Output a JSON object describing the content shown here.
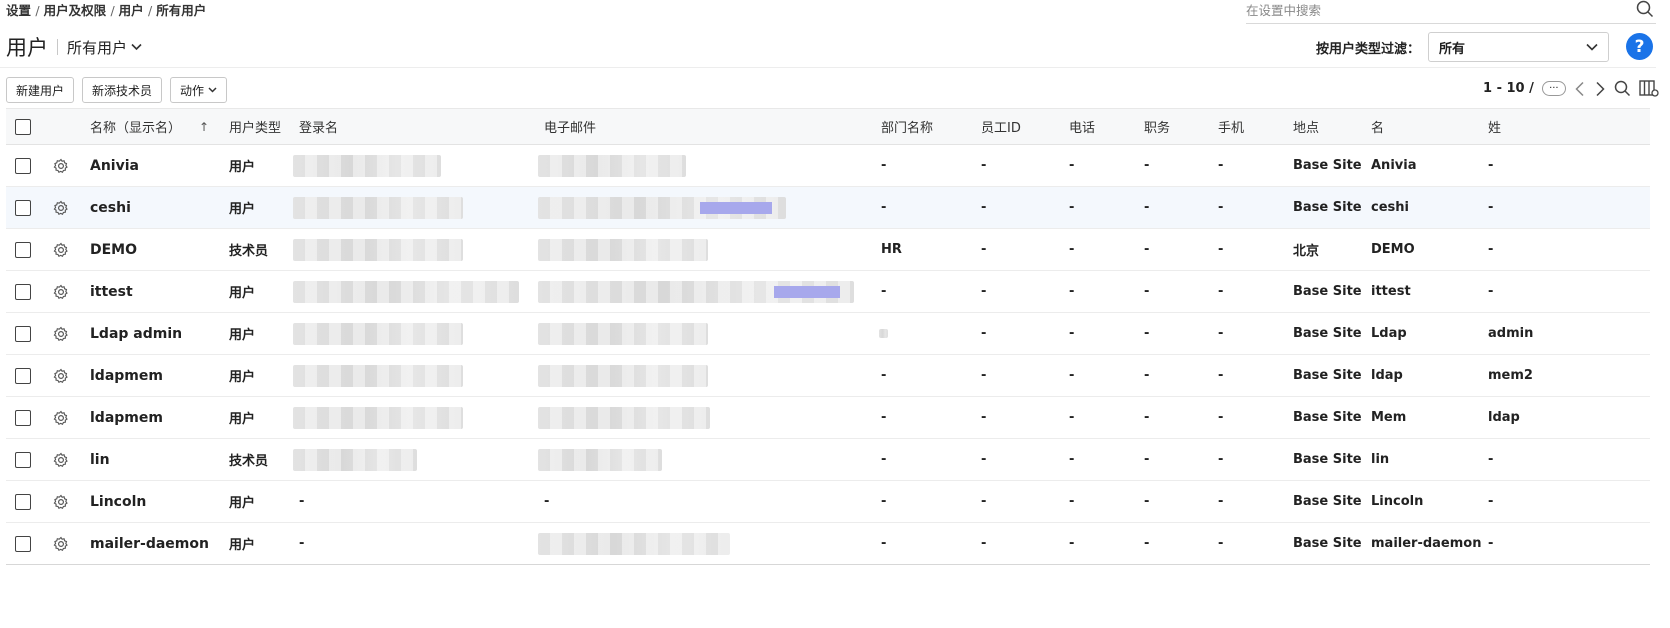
{
  "breadcrumb": [
    "设置",
    "用户及权限",
    "用户",
    "所有用户"
  ],
  "search": {
    "placeholder": "在设置中搜索"
  },
  "header": {
    "title": "用户",
    "view": "所有用户"
  },
  "filter": {
    "label": "按用户类型过滤：",
    "value": "所有"
  },
  "help": {
    "label": "?"
  },
  "toolbar": {
    "new_user": "新建用户",
    "add_technician": "新添技术员",
    "actions": "动作"
  },
  "pager": {
    "text": "1 - 10 /",
    "more": "···"
  },
  "columns": {
    "name": "名称（显示名）",
    "sort": "↑",
    "type": "用户类型",
    "login": "登录名",
    "email": "电子邮件",
    "dept": "部门名称",
    "emp_id": "员工ID",
    "phone": "电话",
    "job": "职务",
    "mobile": "手机",
    "site": "地点",
    "first": "名",
    "last": "姓"
  },
  "rows": [
    {
      "name": "Anivia",
      "type": "用户",
      "login": "",
      "email": "",
      "dept": "-",
      "emp_id": "-",
      "phone": "-",
      "job": "-",
      "mobile": "-",
      "site": "Base Site",
      "first": "Anivia",
      "last": "-"
    },
    {
      "name": "ceshi",
      "type": "用户",
      "login": "",
      "email": "",
      "dept": "-",
      "emp_id": "-",
      "phone": "-",
      "job": "-",
      "mobile": "-",
      "site": "Base Site",
      "first": "ceshi",
      "last": "-"
    },
    {
      "name": "DEMO",
      "type": "技术员",
      "login": "",
      "email": "",
      "dept": "HR",
      "emp_id": "-",
      "phone": "-",
      "job": "-",
      "mobile": "-",
      "site": "北京",
      "first": "DEMO",
      "last": "-"
    },
    {
      "name": "ittest",
      "type": "用户",
      "login": "",
      "email": "",
      "dept": "-",
      "emp_id": "-",
      "phone": "-",
      "job": "-",
      "mobile": "-",
      "site": "Base Site",
      "first": "ittest",
      "last": "-"
    },
    {
      "name": "Ldap admin",
      "type": "用户",
      "login": "",
      "email": "",
      "dept": "",
      "emp_id": "-",
      "phone": "-",
      "job": "-",
      "mobile": "-",
      "site": "Base Site",
      "first": "Ldap",
      "last": "admin"
    },
    {
      "name": "ldapmem",
      "type": "用户",
      "login": "",
      "email": "",
      "dept": "-",
      "emp_id": "-",
      "phone": "-",
      "job": "-",
      "mobile": "-",
      "site": "Base Site",
      "first": "ldap",
      "last": "mem2"
    },
    {
      "name": "ldapmem",
      "type": "用户",
      "login": "",
      "email": "",
      "dept": "-",
      "emp_id": "-",
      "phone": "-",
      "job": "-",
      "mobile": "-",
      "site": "Base Site",
      "first": "Mem",
      "last": "ldap"
    },
    {
      "name": "lin",
      "type": "技术员",
      "login": "",
      "email": "",
      "dept": "-",
      "emp_id": "-",
      "phone": "-",
      "job": "-",
      "mobile": "-",
      "site": "Base Site",
      "first": "lin",
      "last": "-"
    },
    {
      "name": "Lincoln",
      "type": "用户",
      "login": "-",
      "email": "-",
      "dept": "-",
      "emp_id": "-",
      "phone": "-",
      "job": "-",
      "mobile": "-",
      "site": "Base Site",
      "first": "Lincoln",
      "last": "-"
    },
    {
      "name": "mailer-daemon",
      "type": "用户",
      "login": "-",
      "email": "",
      "dept": "-",
      "emp_id": "-",
      "phone": "-",
      "job": "-",
      "mobile": "-",
      "site": "Base Site",
      "first": "mailer-daemon",
      "last": "-"
    }
  ],
  "colors": {
    "accent": "#1a73e8",
    "hover_row": "#f4f8fd",
    "header_bg": "#f7f8f9"
  }
}
